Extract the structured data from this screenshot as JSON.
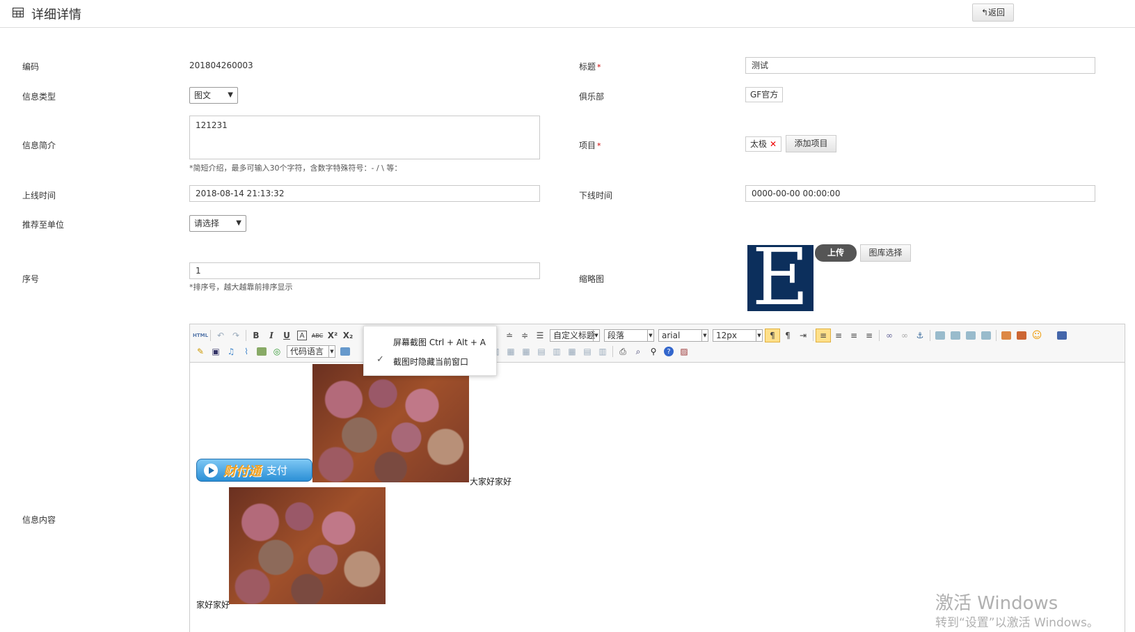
{
  "header": {
    "title": "详细详情",
    "back_label": "↰返回"
  },
  "form": {
    "code": {
      "label": "编码",
      "value": "201804260003"
    },
    "title_field": {
      "label": "标题",
      "required_mark": "*",
      "value": "测试"
    },
    "info_type": {
      "label": "信息类型",
      "selected": "图文"
    },
    "club": {
      "label": "俱乐部",
      "value": "GF官方"
    },
    "summary": {
      "label": "信息简介",
      "value": "121231",
      "hint": "*简短介绍，最多可输入30个字符，含数字特殊符号：- / \\ 等："
    },
    "project": {
      "label": "项目",
      "required_mark": "*",
      "tag": "太极",
      "tag_remove": "✕",
      "add_label": "添加项目"
    },
    "online_time": {
      "label": "上线时间",
      "value": "2018-08-14 21:13:32"
    },
    "offline_time": {
      "label": "下线时间",
      "value": "0000-00-00 00:00:00"
    },
    "recommend": {
      "label": "推荐至单位",
      "selected": "请选择"
    },
    "order": {
      "label": "序号",
      "value": "1",
      "hint": "*排序号，越大越靠前排序显示"
    },
    "thumbnail": {
      "label": "缩略图",
      "letter": "E",
      "upload_label": "上传",
      "gallery_label": "图库选择"
    },
    "content": {
      "label": "信息内容"
    }
  },
  "editor": {
    "html_btn": "HTML",
    "code_lang": "代码语言",
    "heading_select": "自定义标题",
    "paragraph_select": "段落",
    "font_select": "arial",
    "size_select": "12px",
    "body": {
      "pay_brand": "财付通",
      "pay_text": "支付",
      "text1": "大家好家好",
      "text2": "家好家好"
    }
  },
  "context_menu": {
    "item1": "屏幕截图 Ctrl + Alt + A",
    "item2": "截图时隐藏当前窗口",
    "check": "✓"
  },
  "watermark": {
    "line1": "激活 Windows",
    "line2": "转到“设置”以激活 Windows。"
  },
  "colors": {
    "required": "#cc0000",
    "thumbnail_bg": "#0c2f5c",
    "upload_btn": "#555555"
  }
}
